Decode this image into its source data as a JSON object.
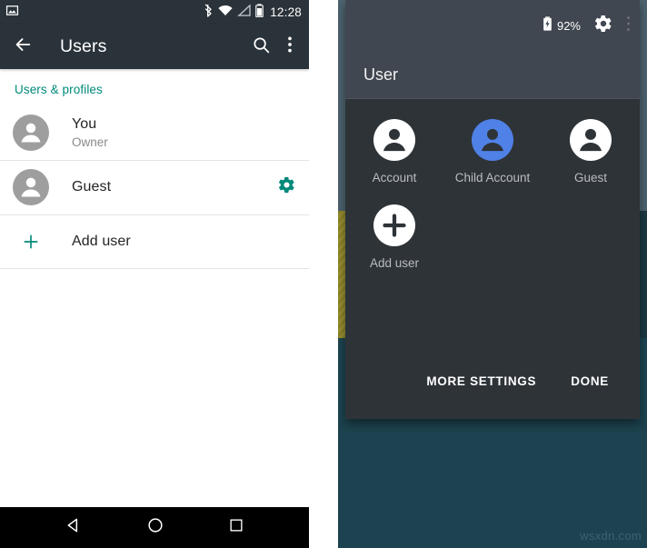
{
  "left_phone": {
    "status_bar": {
      "notification_icon": "screenshot-image-icon",
      "bluetooth_icon": "bluetooth-icon",
      "wifi_icon": "wifi-icon",
      "signal_icon": "cell-signal-icon",
      "battery_icon": "battery-icon",
      "clock": "12:28"
    },
    "app_bar": {
      "back_icon": "back-arrow-icon",
      "title": "Users",
      "search_icon": "search-icon",
      "overflow_icon": "more-vertical-icon"
    },
    "section_header": "Users & profiles",
    "rows": [
      {
        "avatar_icon": "person-avatar-icon",
        "title": "You",
        "subtitle": "Owner",
        "action_icon": ""
      },
      {
        "avatar_icon": "person-avatar-icon",
        "title": "Guest",
        "subtitle": "",
        "action_icon": "gear-icon"
      },
      {
        "avatar_icon": "plus-icon",
        "title": "Add user",
        "subtitle": "",
        "action_icon": ""
      }
    ],
    "nav_bar": {
      "back_icon": "nav-back-triangle-icon",
      "home_icon": "nav-home-circle-icon",
      "recents_icon": "nav-recents-square-icon"
    }
  },
  "right_phone": {
    "status_bar": {
      "battery_icon": "battery-charging-icon",
      "battery_percent": "92%",
      "settings_icon": "gear-icon",
      "overflow_icon": "more-vertical-icon"
    },
    "header_title": "User",
    "users": [
      {
        "label": "Account",
        "icon": "person-avatar-icon",
        "active": false
      },
      {
        "label": "Child Account",
        "icon": "person-avatar-icon",
        "active": true
      },
      {
        "label": "Guest",
        "icon": "person-avatar-icon",
        "active": false
      },
      {
        "label": "Add user",
        "icon": "plus-icon",
        "active": false
      }
    ],
    "footer": {
      "more_settings_label": "MORE SETTINGS",
      "done_label": "DONE"
    }
  },
  "watermark": "wsxdn.com",
  "colors": {
    "teal_accent": "#00897b",
    "app_bar": "#2b333a",
    "qs_panel": "#2e3338",
    "qs_header": "#414750",
    "active_user_blue": "#5081e6",
    "avatar_gray": "#9e9e9e",
    "wallpaper_teal": "#1d4551",
    "wallpaper_yellow": "#9a9130"
  }
}
